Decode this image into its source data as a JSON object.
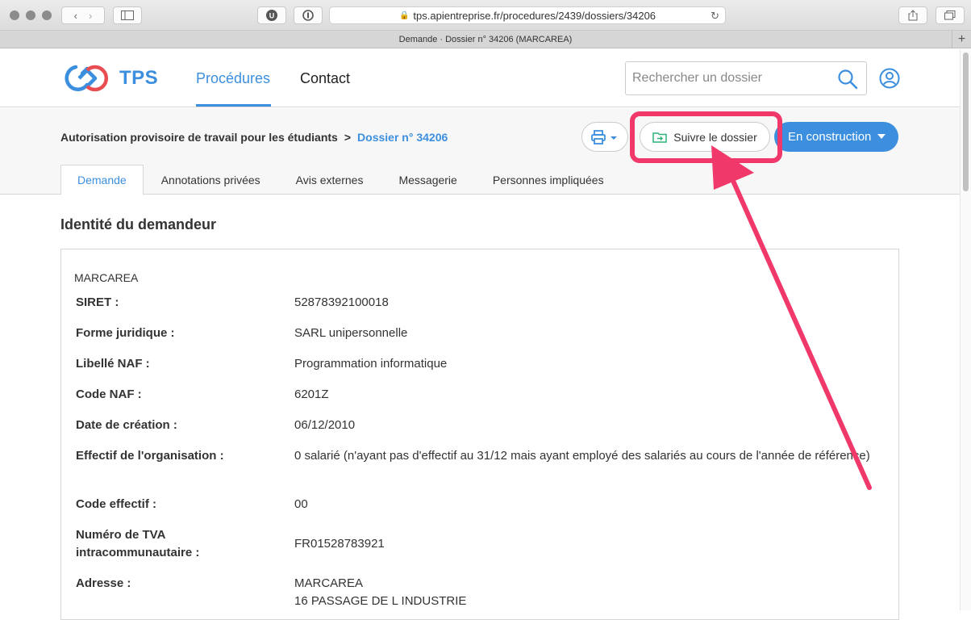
{
  "browser": {
    "url": "tps.apientreprise.fr/procedures/2439/dossiers/34206",
    "tab_title": "Demande · Dossier n° 34206 (MARCAREA)"
  },
  "header": {
    "logo_text": "TPS",
    "nav": {
      "procedures": "Procédures",
      "contact": "Contact"
    },
    "search_placeholder": "Rechercher un dossier"
  },
  "subheader": {
    "breadcrumb_parent": "Autorisation provisoire de travail pour les étudiants",
    "breadcrumb_separator": ">",
    "breadcrumb_current": "Dossier n° 34206",
    "follow_label": "Suivre le dossier",
    "status_label": "En construction"
  },
  "tabs": [
    "Demande",
    "Annotations privées",
    "Avis externes",
    "Messagerie",
    "Personnes impliquées"
  ],
  "section_title": "Identité du demandeur",
  "company_name": "MARCAREA",
  "fields": [
    {
      "label": "SIRET :",
      "value": "52878392100018"
    },
    {
      "label": "Forme juridique :",
      "value": "SARL unipersonnelle"
    },
    {
      "label": "Libellé NAF :",
      "value": "Programmation informatique"
    },
    {
      "label": "Code NAF :",
      "value": "6201Z"
    },
    {
      "label": "Date de création :",
      "value": "06/12/2010"
    },
    {
      "label": "Effectif de l'organisation :",
      "value": "0 salarié (n'ayant pas d'effectif au 31/12 mais ayant employé des salariés au cours de l'année de référence)"
    },
    {
      "label": "Code effectif :",
      "value": "00"
    },
    {
      "label": "Numéro de TVA intracommunautaire :",
      "value": "FR01528783921"
    },
    {
      "label": "Adresse :",
      "value_line1": "MARCAREA",
      "value_line2": "16 PASSAGE DE L INDUSTRIE"
    }
  ],
  "colors": {
    "accent": "#3c8fde",
    "annotation": "#f0386b",
    "logo_red": "#e84d52"
  }
}
